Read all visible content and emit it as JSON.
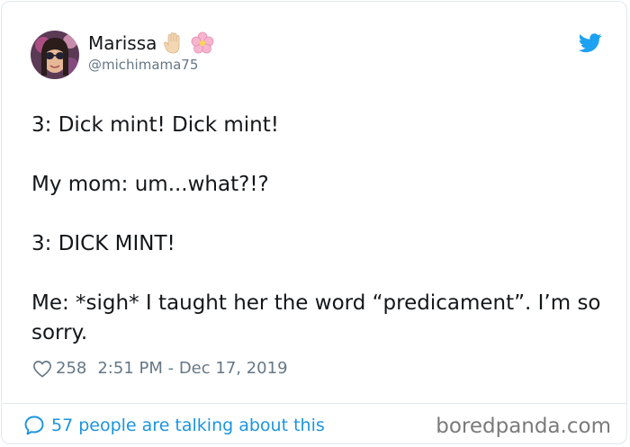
{
  "author": {
    "display_name": "Marissa",
    "handle": "@michimama75",
    "emojis": [
      "raised-hand-emoji",
      "cherry-blossom-emoji"
    ]
  },
  "tweet": {
    "paragraphs": [
      "3: Dick mint! Dick mint!",
      "My mom: um...what?!?",
      "3: DICK MINT!",
      "Me: *sigh* I taught her the word “predicament”. I’m so sorry."
    ],
    "likes": "258",
    "timestamp": "2:51 PM - Dec 17, 2019"
  },
  "footer": {
    "talking_label": "57 people are talking about this",
    "watermark": "boredpanda.com"
  },
  "colors": {
    "twitter_blue": "#1da1f2",
    "link_blue": "#1b95e0",
    "meta_gray": "#657786",
    "border": "#e1e8ed"
  },
  "icons": {
    "brand": "twitter-bird-icon",
    "like": "heart-icon",
    "reply": "speech-bubble-icon"
  }
}
